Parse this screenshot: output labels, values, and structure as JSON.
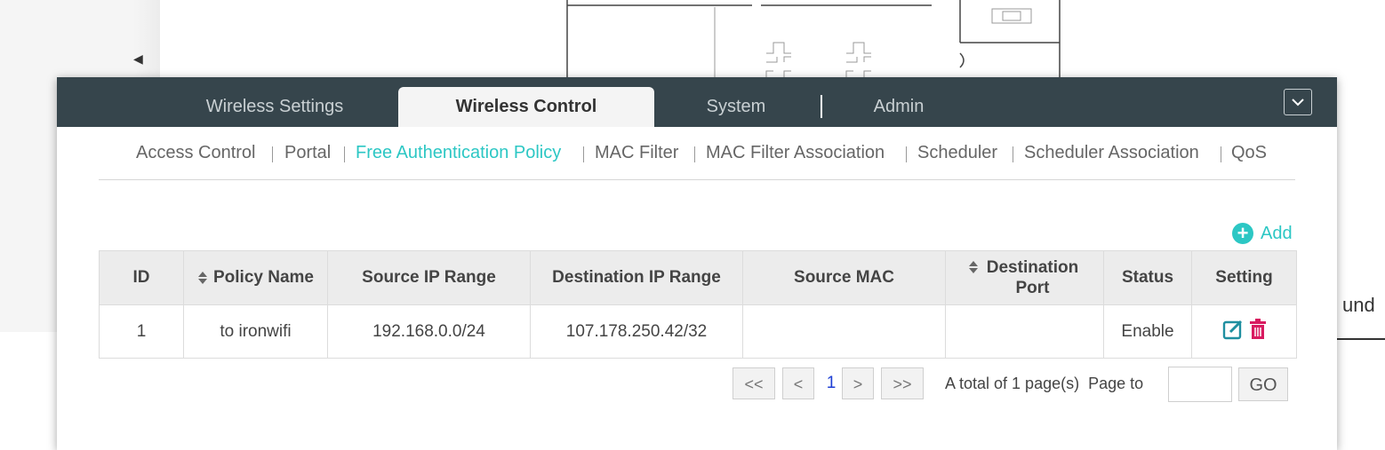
{
  "background": {
    "partial_text": "und"
  },
  "tabs": [
    {
      "label": "Wireless Settings",
      "active": false
    },
    {
      "label": "Wireless Control",
      "active": true
    },
    {
      "label": "System",
      "active": false
    },
    {
      "label": "Admin",
      "active": false
    }
  ],
  "subnav": [
    {
      "label": "Access Control",
      "active": false
    },
    {
      "label": "Portal",
      "active": false
    },
    {
      "label": "Free Authentication Policy",
      "active": true
    },
    {
      "label": "MAC Filter",
      "active": false
    },
    {
      "label": "MAC Filter Association",
      "active": false
    },
    {
      "label": "Scheduler",
      "active": false
    },
    {
      "label": "Scheduler Association",
      "active": false
    },
    {
      "label": "QoS",
      "active": false
    }
  ],
  "add_label": "Add",
  "table": {
    "headers": [
      "ID",
      "Policy Name",
      "Source IP Range",
      "Destination IP Range",
      "Source MAC",
      "Destination Port",
      "Status",
      "Setting"
    ],
    "rows": [
      {
        "id": "1",
        "policy_name": "to ironwifi",
        "source_ip": "192.168.0.0/24",
        "dest_ip": "107.178.250.42/32",
        "source_mac": "",
        "dest_port": "",
        "status": "Enable"
      }
    ]
  },
  "pager": {
    "first": "<<",
    "prev": "<",
    "current": "1",
    "next": ">",
    "last": ">>",
    "total": "A total of 1 page(s)",
    "page_to": "Page to",
    "go": "GO",
    "input_value": ""
  },
  "colors": {
    "accent": "#2cc7c4",
    "tabbar": "#36454c",
    "delete": "#d81b60"
  }
}
